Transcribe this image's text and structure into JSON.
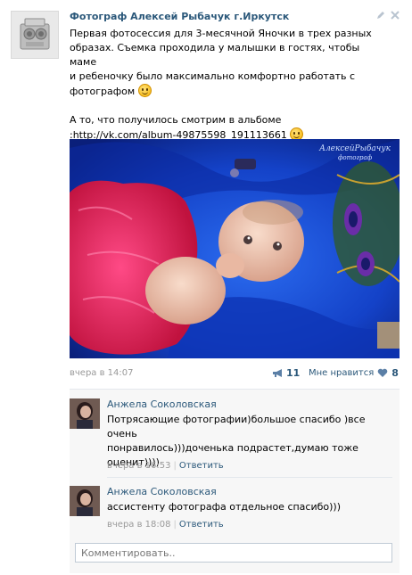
{
  "post": {
    "author": "Фотограф Алексей Рыбачук г.Иркутск",
    "text_lines": [
      "Первая фотосессия для 3-месячной Яночки в трех разных",
      "образах. Съемка проходила у малышки в гостях, чтобы маме",
      "и ребеночку было максимально комфортно работать с",
      "фотографом"
    ],
    "text2_line1": "А то, что получилось смотрим в альбоме",
    "album_link": ":http://vk.com/album-49875598_191113661",
    "watermark": "АлексейРыбачук",
    "watermark_sub": "фотограф",
    "time": "вчера в 14:07",
    "share_count": "11",
    "like_label": "Мне нравится",
    "like_count": "8"
  },
  "comments": [
    {
      "author": "Анжела Соколовская",
      "text_lines": [
        "Потрясающие фотографии)большое спасибо )все очень",
        "понравилось)))доченька подрастет,думаю тоже",
        "оценит))))"
      ],
      "time": "вчера в 16:53",
      "reply": "Ответить"
    },
    {
      "author": "Анжела Соколовская",
      "text_lines": [
        "ассистенту фотографа отдельное спасибо)))"
      ],
      "time": "вчера в 18:08",
      "reply": "Ответить"
    }
  ],
  "comment_input": {
    "placeholder": "Комментировать.."
  },
  "icons": {
    "avatar": "camera-icon",
    "edit": "pencil-icon",
    "delete": "close-icon",
    "share": "megaphone-icon",
    "like": "heart-icon",
    "emoji": "smile-icon"
  },
  "colors": {
    "link": "#2b587a",
    "meta": "#999999",
    "like_heart": "#5b7fa6"
  }
}
